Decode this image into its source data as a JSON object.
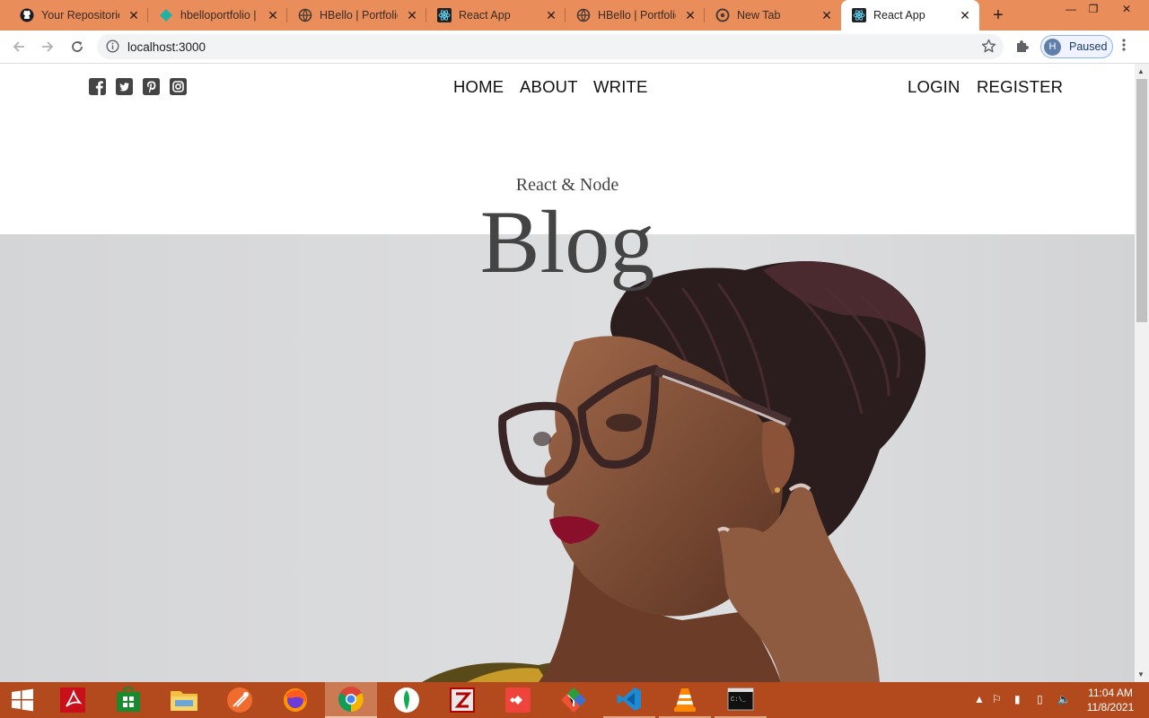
{
  "browser": {
    "tabs": [
      {
        "title": "Your Repositories",
        "icon": "github-icon",
        "active": false
      },
      {
        "title": "hbelloportfolio |",
        "icon": "netlify-icon",
        "active": false
      },
      {
        "title": "HBello | Portfolio",
        "icon": "globe-icon",
        "active": false
      },
      {
        "title": "React App",
        "icon": "react-icon",
        "active": false
      },
      {
        "title": "HBello | Portfolio",
        "icon": "globe-icon",
        "active": false
      },
      {
        "title": "New Tab",
        "icon": "chrome-icon",
        "active": false
      },
      {
        "title": "React App",
        "icon": "react-icon",
        "active": true
      }
    ],
    "url": "localhost:3000",
    "profile": {
      "initial": "H",
      "status": "Paused"
    }
  },
  "site": {
    "nav": {
      "links": [
        "HOME",
        "ABOUT",
        "WRITE"
      ],
      "auth": [
        "LOGIN",
        "REGISTER"
      ],
      "social_icons": [
        "facebook-square-icon",
        "twitter-square-icon",
        "pinterest-square-icon",
        "instagram-square-icon"
      ]
    },
    "header": {
      "subtitle": "React & Node",
      "title": "Blog"
    }
  },
  "taskbar": {
    "apps": [
      "windows-start-icon",
      "acrobat-icon",
      "store-icon",
      "file-explorer-icon",
      "postman-icon",
      "firefox-icon",
      "chrome-icon",
      "mongodb-compass-icon",
      "filezilla-icon",
      "anydesk-icon",
      "git-icon",
      "vscode-icon",
      "vlc-icon",
      "cmd-icon"
    ],
    "time": "11:04 AM",
    "date": "11/8/2021"
  },
  "colors": {
    "tabstrip": "#e98d5b",
    "taskbar": "#b24a1e",
    "hero_bg": "#d7d8da",
    "header_text": "#444444"
  }
}
